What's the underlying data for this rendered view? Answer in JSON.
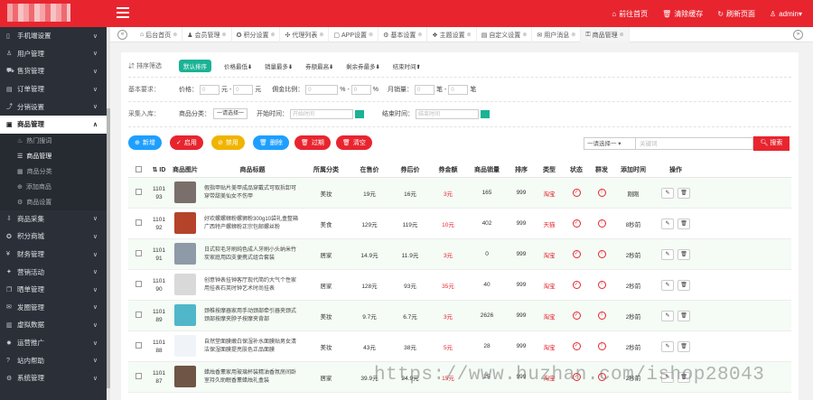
{
  "topnav": [
    {
      "icon": "home-icon",
      "label": "前往首页"
    },
    {
      "icon": "trash-icon",
      "label": "清除缓存"
    },
    {
      "icon": "refresh-icon",
      "label": "刷新页面"
    },
    {
      "icon": "user-icon",
      "label": "admin▾"
    }
  ],
  "sidebar": [
    {
      "icon": "mobile-icon",
      "label": "手机端设置",
      "type": "item"
    },
    {
      "icon": "user-icon",
      "label": "用户管理",
      "type": "item"
    },
    {
      "icon": "cart-icon",
      "label": "售货管理",
      "type": "item"
    },
    {
      "icon": "order-icon",
      "label": "订单管理",
      "type": "item"
    },
    {
      "icon": "share-icon",
      "label": "分销设置",
      "type": "item"
    },
    {
      "icon": "bag-icon",
      "label": "商品管理",
      "type": "item",
      "active": true,
      "chev": "∧"
    },
    {
      "icon": "fire-icon",
      "label": "热门搜词",
      "type": "sub"
    },
    {
      "icon": "list-icon",
      "label": "商品管理",
      "type": "sub",
      "active": true
    },
    {
      "icon": "grid-icon",
      "label": "商品分类",
      "type": "sub"
    },
    {
      "icon": "plus-icon",
      "label": "添加商品",
      "type": "sub"
    },
    {
      "icon": "gear-icon",
      "label": "商品设置",
      "type": "sub"
    },
    {
      "icon": "collect-icon",
      "label": "商品采集",
      "type": "item"
    },
    {
      "icon": "points-icon",
      "label": "积分商城",
      "type": "item"
    },
    {
      "icon": "finance-icon",
      "label": "财务管理",
      "type": "item"
    },
    {
      "icon": "marketing-icon",
      "label": "营销活动",
      "type": "item"
    },
    {
      "icon": "grab-icon",
      "label": "晒单管理",
      "type": "item"
    },
    {
      "icon": "publish-icon",
      "label": "发圈管理",
      "type": "item"
    },
    {
      "icon": "data-icon",
      "label": "虚拟数据",
      "type": "item"
    },
    {
      "icon": "ad-icon",
      "label": "运营推广",
      "type": "item"
    },
    {
      "icon": "help-icon",
      "label": "站内帮助",
      "type": "item"
    },
    {
      "icon": "system-icon",
      "label": "系统管理",
      "type": "item"
    }
  ],
  "tabs": [
    {
      "icon": "dashboard-icon",
      "label": "后台首页"
    },
    {
      "icon": "users-icon",
      "label": "会员管理"
    },
    {
      "icon": "points-icon",
      "label": "积分设置"
    },
    {
      "icon": "agent-icon",
      "label": "代理列表"
    },
    {
      "icon": "app-icon",
      "label": "APP设置"
    },
    {
      "icon": "gear-icon",
      "label": "基本设置"
    },
    {
      "icon": "theme-icon",
      "label": "主题设置"
    },
    {
      "icon": "custom-icon",
      "label": "自定义设置"
    },
    {
      "icon": "message-icon",
      "label": "用户消息"
    },
    {
      "icon": "lock-icon",
      "label": "商品管理",
      "active": true
    }
  ],
  "filters": {
    "sort_label": "排序筛选",
    "sort_default": "默认排序",
    "sorts": [
      {
        "label": "价格最低",
        "dir": "⬇"
      },
      {
        "label": "销量最多",
        "dir": "⬇"
      },
      {
        "label": "券额最高",
        "dir": "⬇"
      },
      {
        "label": "剩余券最多",
        "dir": "⬇"
      },
      {
        "label": "结束时间",
        "dir": "⬆"
      }
    ],
    "basic_label": "基本要求：",
    "price_label": "价格：",
    "price_from": "0",
    "yuan": "元",
    "price_to": "0",
    "commission_label": "佣金比例：",
    "pct_from": "0",
    "pct": "%",
    "pct_to": "0",
    "sales_label": "月销量：",
    "sales_from": "0",
    "sales_unit1": "笔 -",
    "sales_to": "0",
    "sales_unit2": "笔",
    "collect_label": "采集入库：",
    "category_label": "商品分类：",
    "category_value": "一请选择一",
    "start_label": "开始时间：",
    "start_placeholder": "开始时间",
    "end_label": "结束时间：",
    "end_placeholder": "结束时间"
  },
  "actions": [
    {
      "icon": "plus-icon",
      "label": "新增",
      "color": "#1e9fff"
    },
    {
      "icon": "check-icon",
      "label": "启用",
      "color": "#e8252f"
    },
    {
      "icon": "ban-icon",
      "label": "禁用",
      "color": "#f0b400"
    },
    {
      "icon": "trash-icon",
      "label": "删除",
      "color": "#1e9fff"
    },
    {
      "icon": "trash-icon",
      "label": "过期",
      "color": "#e8252f"
    },
    {
      "icon": "trash-icon",
      "label": "清空",
      "color": "#e8252f"
    }
  ],
  "search": {
    "select": "一请选择一 ▾",
    "placeholder": "关键词",
    "button": "搜索"
  },
  "table": {
    "headers": [
      "ID",
      "商品图片",
      "商品标题",
      "所属分类",
      "在售价",
      "券后价",
      "券金额",
      "商品销量",
      "排序",
      "类型",
      "状态",
      "群发",
      "添加时间",
      "操作"
    ],
    "rows": [
      {
        "id": "1101\n93",
        "title": "假指甲贴片美甲成品穿戴式可取拆卸可穿带甜美仙女不伤甲",
        "cat": "美妆",
        "price": "19元",
        "after": "16元",
        "coupon": "3元",
        "sales": "165",
        "sort": "999",
        "type": "淘宝",
        "time": "刚刚",
        "thumb": "#7a6f6a"
      },
      {
        "id": "1101\n92",
        "title": "好欢螺螺蛳粉螺狮粉300g10袋礼盒整箱广西特产螺蛳粉正宗包邮螺丝粉",
        "cat": "美食",
        "price": "129元",
        "after": "119元",
        "coupon": "10元",
        "sales": "402",
        "sort": "999",
        "type": "天猫",
        "time": "8秒前",
        "thumb": "#b5432a"
      },
      {
        "id": "1101\n91",
        "title": "日式软毛牙刷纯色成人牙刷小头纳米竹炭家庭用四支便携式组合套装",
        "cat": "居家",
        "price": "14.9元",
        "after": "11.9元",
        "coupon": "3元",
        "sales": "0",
        "sort": "999",
        "type": "淘宝",
        "time": "2秒前",
        "thumb": "#8e9aa8"
      },
      {
        "id": "1101\n90",
        "title": "创意钟表挂钟客厅现代简约大气个性家用挂表石英时钟艺术时尚挂表",
        "cat": "居家",
        "price": "128元",
        "after": "93元",
        "coupon": "35元",
        "sales": "40",
        "sort": "999",
        "type": "淘宝",
        "time": "2秒前",
        "thumb": "#d9d9d9"
      },
      {
        "id": "1101\n89",
        "title": "颈椎按摩器家用手动颈部牵引器夹颈式颈部按摩夹脖子按摩夹背部",
        "cat": "美妆",
        "price": "9.7元",
        "after": "6.7元",
        "coupon": "3元",
        "sales": "2626",
        "sort": "999",
        "type": "淘宝",
        "time": "2秒前",
        "thumb": "#4fb7c9"
      },
      {
        "id": "1101\n88",
        "title": "自然堂面膜嫩白保湿补水面膜贴男女清洁保湿面膜提亮肤色正品面膜",
        "cat": "美妆",
        "price": "43元",
        "after": "38元",
        "coupon": "5元",
        "sales": "28",
        "sort": "999",
        "type": "淘宝",
        "time": "2秒前",
        "thumb": "#f0f4f8"
      },
      {
        "id": "1101\n87",
        "title": "蜡烛香薰家用玻璃杯装精油香氛房间卧室持久助眠香薰蜡烛礼盒装",
        "cat": "居家",
        "price": "39.9元",
        "after": "24.9元",
        "coupon": "15元",
        "sales": "25",
        "sort": "999",
        "type": "淘宝",
        "time": "2秒前",
        "thumb": "#6e5545"
      }
    ]
  },
  "watermark": "https://www.huzhan.com/ishop28043"
}
